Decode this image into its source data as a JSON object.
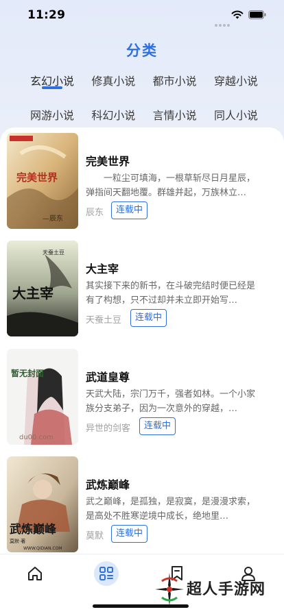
{
  "status_bar": {
    "time": "11:29"
  },
  "page": {
    "title": "分类"
  },
  "categories": [
    {
      "label": "玄幻小说",
      "active": true
    },
    {
      "label": "修真小说",
      "active": false
    },
    {
      "label": "都市小说",
      "active": false
    },
    {
      "label": "穿越小说",
      "active": false
    },
    {
      "label": "网游小说",
      "active": false
    },
    {
      "label": "科幻小说",
      "active": false
    },
    {
      "label": "言情小说",
      "active": false
    },
    {
      "label": "同人小说",
      "active": false
    }
  ],
  "books": [
    {
      "title": "完美世界",
      "desc": "　　一粒尘可填海，一根草斩尽日月星辰，弹指间天翻地覆。群雄并起，万族林立…",
      "author": "辰东",
      "status": "连载中",
      "cover_text": "完美世界",
      "cover_author": "—辰东"
    },
    {
      "title": "大主宰",
      "desc": "其实接下来的新书，在斗破完结时便已经是有了构想，只不过却并未立即开始写…",
      "author": "天蚕土豆",
      "status": "连载中",
      "cover_text": "大主宰",
      "cover_author": "天蚕土豆"
    },
    {
      "title": "武道皇尊",
      "desc": "天武大陆，宗门万千，强者如林。一个小家族分支弟子，因为一次意外的穿越，…",
      "author": "异世的剑客",
      "status": "连载中",
      "cover_text": "暂无封面",
      "cover_author": "du00.com"
    },
    {
      "title": "武炼巅峰",
      "desc": "武之巅峰，是孤独，是寂寞，是漫漫求索，是高处不胜寒逆境中成长，绝地里…",
      "author": "莫默",
      "status": "连载中",
      "cover_text": "武炼巅峰",
      "cover_author": "莫默·著",
      "cover_site": "WWW.QIDIAN.COM"
    }
  ],
  "tabbar": [
    {
      "icon": "home-icon",
      "active": false
    },
    {
      "icon": "category-icon",
      "active": true
    },
    {
      "icon": "bookmark-icon",
      "active": false
    },
    {
      "icon": "profile-icon",
      "active": false
    }
  ],
  "watermark": {
    "text": "超人手游网"
  },
  "colors": {
    "accent": "#2f6fe0",
    "background": "#e3eaf9"
  }
}
